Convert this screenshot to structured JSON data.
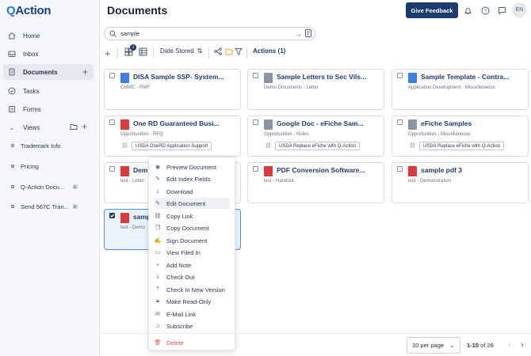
{
  "app": {
    "logo_q": "Q",
    "logo_text": "Action"
  },
  "sidebar": {
    "home": "Home",
    "inbox": "Inbox",
    "documents": "Documents",
    "tasks": "Tasks",
    "forms": "Forms",
    "views": "Views",
    "view_items": [
      {
        "label": "Trademark Info"
      },
      {
        "label": "Pricing"
      },
      {
        "label": "Q-Action Docu..."
      },
      {
        "label": "Send 567C Tran..."
      }
    ]
  },
  "header": {
    "title": "Documents",
    "feedback": "Give Feedback",
    "avatar": "EN"
  },
  "search": {
    "value": "sample"
  },
  "toolbar": {
    "add": "+",
    "badge": "1",
    "sort": "Date Stored",
    "actions": "Actions (1)"
  },
  "cards": [
    {
      "title": "DISA Sample SSP- System...",
      "meta": "CMMC - RMF",
      "tag": "",
      "icon": "word",
      "selected": false
    },
    {
      "title": "Sample Letters to Sec Vils...",
      "meta": "Demo Documents - Letter",
      "tag": "",
      "icon": "doc",
      "selected": false
    },
    {
      "title": "Sample Template - Contra...",
      "meta": "Application Development - Miscellaneous",
      "tag": "",
      "icon": "word",
      "selected": false
    },
    {
      "title": "One RD Guaranteed Busi...",
      "meta": "Opportunities - RFQ",
      "tag": "USDA OneRD Application Support",
      "icon": "pdf",
      "selected": false
    },
    {
      "title": "Google Doc - eFiche Sam...",
      "meta": "Opportunities - Notes",
      "tag": "USDA Replace eFiche with Q-Action",
      "icon": "doc",
      "selected": false
    },
    {
      "title": "eFiche Samples",
      "meta": "Opportunities - Miscellaneous",
      "tag": "USDA Replace eFiche with Q-Action",
      "icon": "doc",
      "selected": false
    },
    {
      "title": "Dem",
      "meta": "test - Letter",
      "tag": "",
      "icon": "pdf",
      "selected": false
    },
    {
      "title": "PDF Conversion Software...",
      "meta": "test - Handout",
      "tag": "",
      "icon": "pdf",
      "selected": false
    },
    {
      "title": "sample pdf 3",
      "meta": "test - Demonstration",
      "tag": "",
      "icon": "pdf",
      "selected": false
    },
    {
      "title": "samp",
      "meta": "test - Demo",
      "tag": "",
      "icon": "pdf",
      "selected": true
    }
  ],
  "menu": [
    {
      "label": "Preview Document",
      "icon": "eye-icon",
      "glyph": "◉"
    },
    {
      "label": "Edit Index Fields",
      "icon": "pencil-icon",
      "glyph": "✎"
    },
    {
      "label": "Download",
      "icon": "download-icon",
      "glyph": "⤓"
    },
    {
      "label": "Edit Document",
      "icon": "edit-icon",
      "glyph": "✎"
    },
    {
      "label": "Copy Link",
      "icon": "link-icon",
      "glyph": "⛓"
    },
    {
      "label": "Copy Document",
      "icon": "copy-icon",
      "glyph": "❐"
    },
    {
      "label": "Sign Document",
      "icon": "signature-icon",
      "glyph": "✍"
    },
    {
      "label": "View Filed In",
      "icon": "folder-icon",
      "glyph": "▭"
    },
    {
      "label": "Add Note",
      "icon": "plus-icon",
      "glyph": "+"
    },
    {
      "label": "Check Out",
      "icon": "checkout-icon",
      "glyph": "⤓"
    },
    {
      "label": "Check In New Version",
      "icon": "checkin-icon",
      "glyph": "⤒"
    },
    {
      "label": "Make Read-Only",
      "icon": "lock-icon",
      "glyph": "🔒︎"
    },
    {
      "label": "E-Mail Link",
      "icon": "mail-icon",
      "glyph": "✉"
    },
    {
      "label": "Subscribe",
      "icon": "bell-icon",
      "glyph": "♫"
    },
    {
      "label": "Delete",
      "icon": "trash-icon",
      "glyph": "🗑︎"
    }
  ],
  "footer": {
    "per_page": "10 per page",
    "range": "1-10",
    "of": "of 28"
  },
  "colors": {
    "primary": "#1b3b6f",
    "pdf": "#d93a3a",
    "word": "#3f7fe0",
    "selected_border": "#4a8fe0",
    "danger": "#e05252"
  }
}
